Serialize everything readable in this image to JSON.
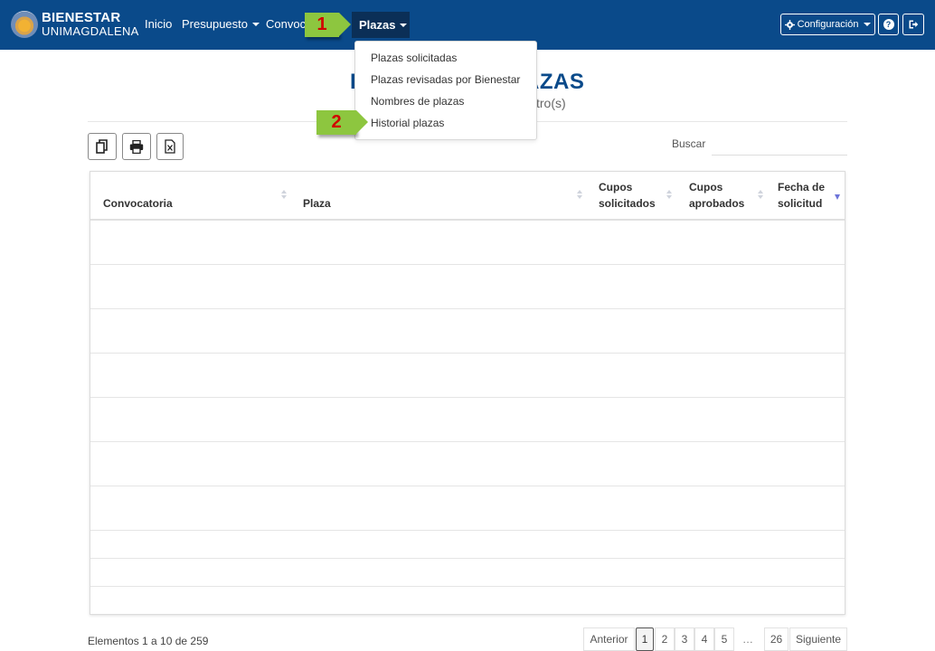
{
  "navbar": {
    "brand_top": "BIENESTAR",
    "brand_bottom": "UNIMAGDALENA",
    "items": [
      {
        "label": "Inicio"
      },
      {
        "label": "Presupuesto"
      },
      {
        "label": "Convoca"
      },
      {
        "label": "Plazas"
      }
    ],
    "config_label": "Configuración",
    "help_icon": "question-circle-icon",
    "logout_icon": "sign-out-icon",
    "colors": {
      "bar": "#0a4a8a",
      "active": "#0b2f57"
    }
  },
  "callouts": [
    {
      "label": "1"
    },
    {
      "label": "2"
    }
  ],
  "dropdown": {
    "items": [
      {
        "label": "Plazas solicitadas"
      },
      {
        "label": "Plazas revisadas por Bienestar"
      },
      {
        "label": "Nombres de plazas"
      },
      {
        "label": "Historial plazas"
      }
    ]
  },
  "page": {
    "title_visible": "AZAS",
    "title_left_fragment": "L",
    "subtitle_fragment": "stro(s)"
  },
  "toolbar": {
    "buttons": [
      {
        "icon": "copy-icon"
      },
      {
        "icon": "print-icon"
      },
      {
        "icon": "excel-icon"
      }
    ],
    "search_label": "Buscar",
    "search_value": ""
  },
  "table": {
    "columns": [
      {
        "label": "Convocatoria"
      },
      {
        "label": "Plaza"
      },
      {
        "label": "Cupos solicitados",
        "line1": "Cupos",
        "line2": "solicitados"
      },
      {
        "label": "Cupos aprobados",
        "line1": "Cupos",
        "line2": "aprobados"
      },
      {
        "label": "Fecha de solicitud",
        "line1": "Fecha de",
        "line2": "solicitud"
      }
    ],
    "rows": []
  },
  "footer": {
    "info": "Elementos 1 a 10 de 259",
    "pagination": {
      "prev": "Anterior",
      "pages": [
        "1",
        "2",
        "3",
        "4",
        "5"
      ],
      "ellipsis": "…",
      "last": "26",
      "next": "Siguiente",
      "current": "1"
    }
  }
}
